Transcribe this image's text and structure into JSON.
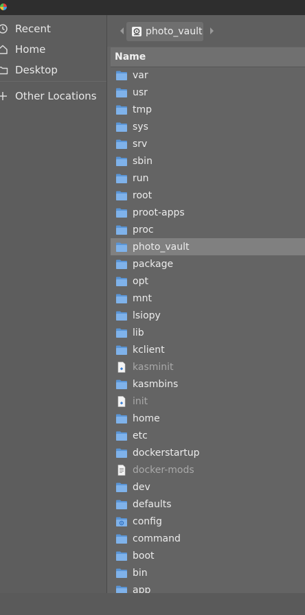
{
  "sidebar": {
    "items": [
      {
        "label": "Recent",
        "icon": "clock-icon"
      },
      {
        "label": "Home",
        "icon": "home-icon"
      },
      {
        "label": "Desktop",
        "icon": "desktop-folder-icon"
      },
      {
        "label": "Other Locations",
        "icon": "plus-icon"
      }
    ]
  },
  "pathbar": {
    "back_icon": "chevron-left-icon",
    "forward_icon": "chevron-right-icon",
    "crumb_label": "photo_vault",
    "crumb_icon": "drive-icon"
  },
  "list": {
    "header": "Name",
    "selected": "photo_vault",
    "rows": [
      {
        "name": "var",
        "type": "folder"
      },
      {
        "name": "usr",
        "type": "folder"
      },
      {
        "name": "tmp",
        "type": "folder"
      },
      {
        "name": "sys",
        "type": "folder"
      },
      {
        "name": "srv",
        "type": "folder"
      },
      {
        "name": "sbin",
        "type": "folder"
      },
      {
        "name": "run",
        "type": "folder"
      },
      {
        "name": "root",
        "type": "folder"
      },
      {
        "name": "proot-apps",
        "type": "folder"
      },
      {
        "name": "proc",
        "type": "folder"
      },
      {
        "name": "photo_vault",
        "type": "folder"
      },
      {
        "name": "package",
        "type": "folder"
      },
      {
        "name": "opt",
        "type": "folder"
      },
      {
        "name": "mnt",
        "type": "folder"
      },
      {
        "name": "lsiopy",
        "type": "folder"
      },
      {
        "name": "lib",
        "type": "folder"
      },
      {
        "name": "kclient",
        "type": "folder"
      },
      {
        "name": "kasminit",
        "type": "executable"
      },
      {
        "name": "kasmbins",
        "type": "folder"
      },
      {
        "name": "init",
        "type": "executable"
      },
      {
        "name": "home",
        "type": "folder"
      },
      {
        "name": "etc",
        "type": "folder"
      },
      {
        "name": "dockerstartup",
        "type": "folder"
      },
      {
        "name": "docker-mods",
        "type": "text-file"
      },
      {
        "name": "dev",
        "type": "folder"
      },
      {
        "name": "defaults",
        "type": "folder"
      },
      {
        "name": "config",
        "type": "config-folder"
      },
      {
        "name": "command",
        "type": "folder"
      },
      {
        "name": "boot",
        "type": "folder"
      },
      {
        "name": "bin",
        "type": "folder"
      },
      {
        "name": "app",
        "type": "folder"
      }
    ]
  },
  "colors": {
    "folder": "#7fb2ea",
    "folder_tab": "#5a95d6",
    "selected_row": "#808080",
    "dim_text": "#a9a9a9"
  }
}
